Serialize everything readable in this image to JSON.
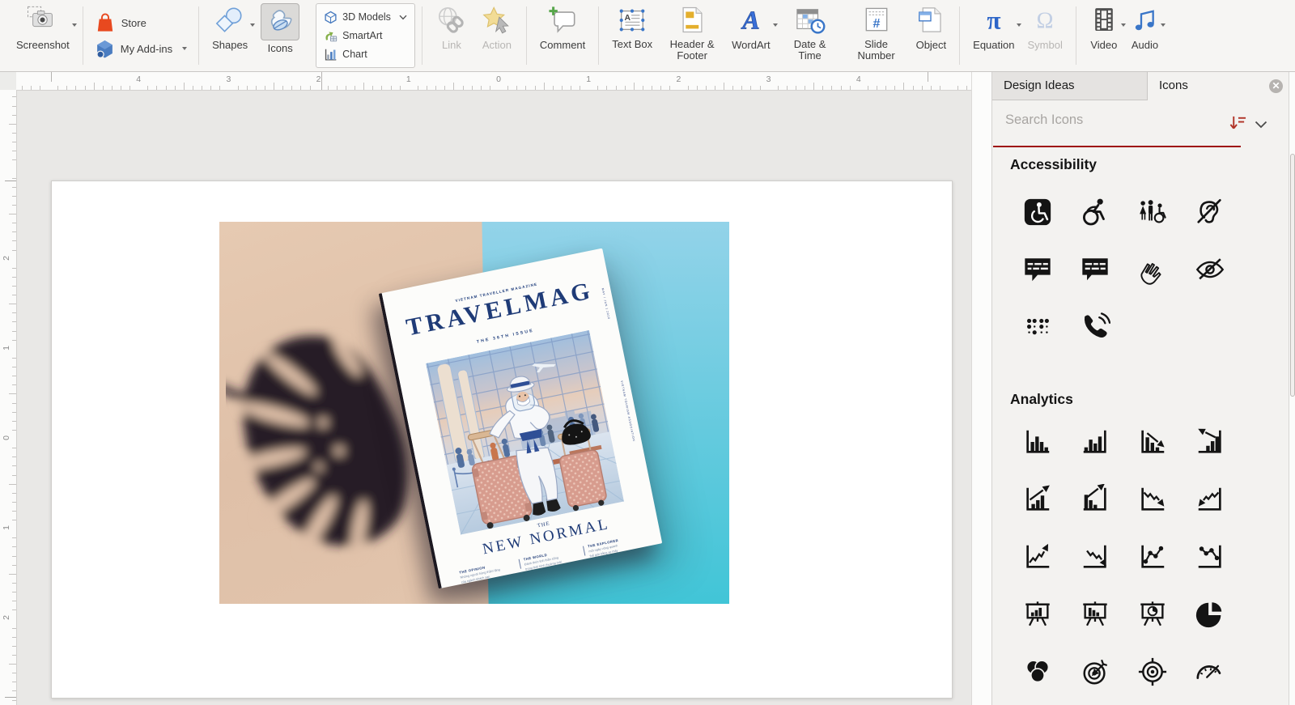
{
  "ribbon": {
    "groups": [
      {
        "buttons": [
          {
            "label": "Screenshot",
            "icon": "screenshot",
            "caret": true
          }
        ]
      },
      {
        "stacked": true,
        "buttons": [
          {
            "label": "Store",
            "icon": "store"
          },
          {
            "label": "My Add-ins",
            "icon": "addins",
            "caret": true
          }
        ]
      },
      {
        "nodiv": true,
        "buttons": [
          {
            "label": "Shapes",
            "icon": "shapes",
            "caret": true
          },
          {
            "label": "Icons",
            "icon": "duck",
            "selected": true
          }
        ]
      },
      {
        "boxed": true,
        "buttons": [
          {
            "label": "3D Models",
            "icon": "models3d",
            "caret": true
          },
          {
            "label": "SmartArt",
            "icon": "smartart"
          },
          {
            "label": "Chart",
            "icon": "chart"
          }
        ]
      },
      {
        "buttons": [
          {
            "label": "Link",
            "icon": "link",
            "disabled": true
          },
          {
            "label": "Action",
            "icon": "action",
            "disabled": true
          }
        ]
      },
      {
        "buttons": [
          {
            "label": "Comment",
            "icon": "comment"
          }
        ]
      },
      {
        "buttons": [
          {
            "label": "Text Box",
            "icon": "textbox",
            "two": true
          },
          {
            "label": "Header & Footer",
            "icon": "headerfooter",
            "two": true
          },
          {
            "label": "WordArt",
            "icon": "wordart",
            "caret": true
          },
          {
            "label": "Date & Time",
            "icon": "datetime",
            "two": true
          },
          {
            "label": "Slide Number",
            "icon": "slidenumber",
            "two": true
          },
          {
            "label": "Object",
            "icon": "object"
          }
        ]
      },
      {
        "buttons": [
          {
            "label": "Equation",
            "icon": "equation",
            "caret": true
          },
          {
            "label": "Symbol",
            "icon": "symbol",
            "disabled": true
          }
        ]
      },
      {
        "buttons": [
          {
            "label": "Video",
            "icon": "video",
            "caret": true
          },
          {
            "label": "Audio",
            "icon": "audio",
            "caret": true
          }
        ]
      }
    ]
  },
  "rulers": {
    "horizontal": [
      "4",
      "3",
      "2",
      "1",
      "0",
      "1",
      "2",
      "3",
      "4"
    ],
    "vertical": [
      "2",
      "1",
      "0",
      "1",
      "2"
    ]
  },
  "panel": {
    "tabs": [
      {
        "label": "Design Ideas"
      },
      {
        "label": "Icons"
      }
    ],
    "active_tab": "Icons",
    "search_placeholder": "Search Icons",
    "accent_color": "#9e1111",
    "sections": [
      {
        "title": "Accessibility",
        "icons": [
          "accessibility-symbol",
          "wheelchair-user",
          "family-accessibility",
          "deaf-assistance",
          "closed-captioning",
          "closed-captioning-alt",
          "sign-language",
          "visually-impaired",
          "braille",
          "assistive-phone"
        ]
      },
      {
        "title": "Analytics",
        "icons": [
          "bar-chart",
          "column-chart",
          "bar-chart-decline",
          "bar-chart-growth",
          "bar-chart-rise",
          "bar-chart-rise-alt",
          "line-chart-decline",
          "line-chart-recovery",
          "line-chart-growth",
          "line-chart-drop",
          "dot-line-chart-up",
          "dot-line-chart-down",
          "presentation-bar-rise",
          "presentation-bar-fall",
          "presentation-pie",
          "pie-chart",
          "venn-diagram",
          "dartboard",
          "crosshair-target",
          "speedometer"
        ]
      }
    ]
  },
  "slide": {
    "magazine": {
      "masthead": "VIETNAM TRAVELLER MAGAZINE",
      "title": "TRAVELMAG",
      "issue": "THE 36TH ISSUE",
      "the": "THE",
      "subtitle": "NEW NORMAL",
      "side_top": "MAY / JUN | 2020",
      "side_bottom": "VIETNAM TOURISM ASSOCIATION",
      "footers": [
        {
          "h": "THE OPINION",
          "l1": "Những người hùng thầm lặng",
          "l2": "của ngành khách sạn"
        },
        {
          "h": "THE WORLD",
          "l1": "Đánh thức tinh thần sống",
          "l2": "trong thời bình thường mới"
        },
        {
          "h": "THE EXPLORER",
          "l1": "một ngày vòng quanh",
          "l2": "thế giới bằng xe máy"
        }
      ]
    }
  }
}
